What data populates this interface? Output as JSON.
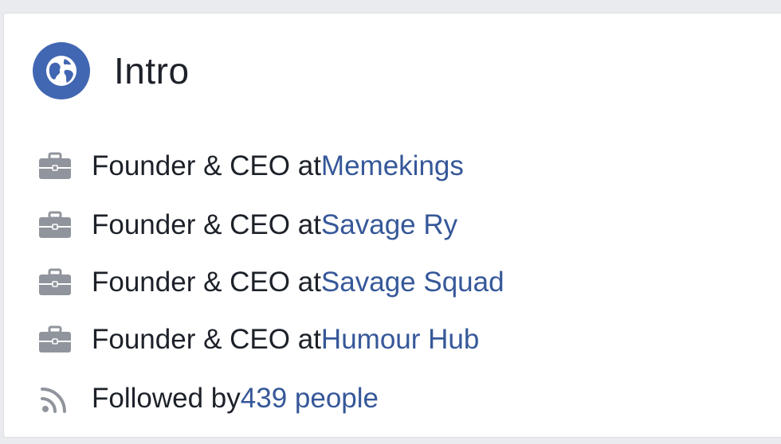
{
  "intro": {
    "title": "Intro",
    "work_items": [
      {
        "prefix": "Founder & CEO at ",
        "company": "Memekings"
      },
      {
        "prefix": "Founder & CEO at ",
        "company": "Savage Ry"
      },
      {
        "prefix": "Founder & CEO at ",
        "company": "Savage Squad"
      },
      {
        "prefix": "Founder & CEO at ",
        "company": "Humour Hub"
      }
    ],
    "followers": {
      "prefix": "Followed by ",
      "link": "439 people"
    }
  },
  "colors": {
    "accent": "#4267b2",
    "link": "#365899",
    "text": "#1d2129",
    "icon": "#90949c",
    "background": "#e9ebee"
  },
  "icons": [
    "globe-icon",
    "briefcase-icon",
    "rss-feed-icon"
  ]
}
